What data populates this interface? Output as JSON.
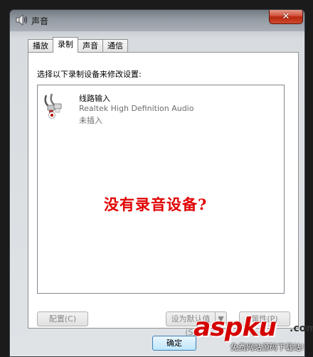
{
  "window": {
    "title": "声音",
    "close_label": "✕",
    "icon": "speaker-icon"
  },
  "tabs": [
    {
      "label": "播放",
      "active": false
    },
    {
      "label": "录制",
      "active": true
    },
    {
      "label": "声音",
      "active": false
    },
    {
      "label": "通信",
      "active": false
    }
  ],
  "panel": {
    "instruction": "选择以下录制设备来修改设置:",
    "devices": [
      {
        "name": "线路输入",
        "driver": "Realtek High Definition Audio",
        "status": "未插入",
        "icon": "line-in-cable-icon",
        "status_icon": "unplugged-status-icon"
      }
    ],
    "overlay_text": "没有录音设备?"
  },
  "buttons": {
    "configure": "配置(C)",
    "set_default": "设为默认值(S)",
    "set_default_arrow": "▼",
    "properties": "属性(P)",
    "ok": "确定"
  },
  "watermark": {
    "logo": "aspku",
    "suffix": ".com",
    "subtitle": "免费网站源码下载站!"
  },
  "colors": {
    "overlay_text": "#e00000",
    "close_button": "#c7391c",
    "watermark": "#d40000"
  }
}
